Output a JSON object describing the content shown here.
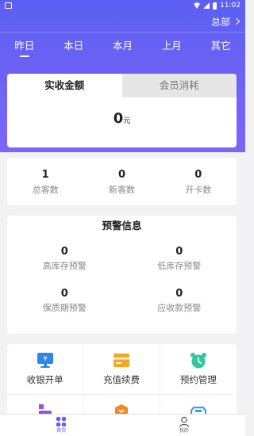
{
  "status_bar": {
    "time": "11:02"
  },
  "header": {
    "store_label": "总部"
  },
  "period_tabs": [
    {
      "label": "昨日",
      "active": true
    },
    {
      "label": "本日",
      "active": false
    },
    {
      "label": "本月",
      "active": false
    },
    {
      "label": "上月",
      "active": false
    },
    {
      "label": "其它",
      "active": false
    }
  ],
  "amount_card": {
    "tabs": [
      {
        "label": "实收金额",
        "active": true
      },
      {
        "label": "会员消耗",
        "active": false
      }
    ],
    "value": "0",
    "unit": "元"
  },
  "stats": [
    {
      "value": "1",
      "label": "总客数"
    },
    {
      "value": "0",
      "label": "新客数"
    },
    {
      "value": "0",
      "label": "开卡数"
    }
  ],
  "alerts": {
    "title": "预警信息",
    "items": [
      {
        "value": "0",
        "label": "高库存预警"
      },
      {
        "value": "0",
        "label": "低库存预警"
      },
      {
        "value": "0",
        "label": "保质期预警"
      },
      {
        "value": "0",
        "label": "应收款预警"
      }
    ]
  },
  "menu": [
    {
      "label": "收银开单",
      "icon": "cashier-monitor-icon",
      "color": "#2f86e6"
    },
    {
      "label": "充值续费",
      "icon": "recharge-card-icon",
      "color": "#f5a623"
    },
    {
      "label": "预约管理",
      "icon": "alarm-clock-icon",
      "color": "#2fc6a0"
    },
    {
      "label": "",
      "icon": "purple-folder-icon",
      "color": "#9b4fe0"
    },
    {
      "label": "",
      "icon": "orange-shield-icon",
      "color": "#f08a24"
    },
    {
      "label": "",
      "icon": "blue-tray-icon",
      "color": "#3aa0e8"
    }
  ],
  "bottom_nav": [
    {
      "label": "首页",
      "icon": "home-grid-icon",
      "active": true
    },
    {
      "label": "我的",
      "icon": "profile-icon",
      "active": false
    }
  ],
  "colors": {
    "primary": "#6a5cf5",
    "header_top": "#5b5ff1",
    "header_bottom": "#7c66f8"
  }
}
